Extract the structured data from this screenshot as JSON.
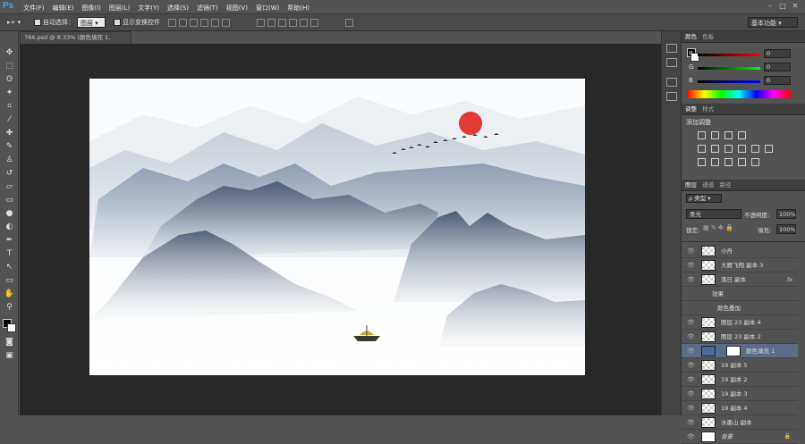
{
  "app": {
    "logo": "Ps"
  },
  "menu": [
    "文件(F)",
    "编辑(E)",
    "图像(I)",
    "图层(L)",
    "文字(Y)",
    "选择(S)",
    "滤镜(T)",
    "视图(V)",
    "窗口(W)",
    "帮助(H)"
  ],
  "options": {
    "auto_select_label": "自动选择：",
    "auto_select_value": "图层",
    "show_transform_label": "显示变换控件",
    "workspace": "基本功能"
  },
  "document": {
    "tab": "766.psd @ 8.33% (颜色填充 1, RGB/8)"
  },
  "color_panel": {
    "tabs": [
      "颜色",
      "色板"
    ],
    "r": {
      "label": "R",
      "value": "0"
    },
    "g": {
      "label": "G",
      "value": "0"
    },
    "b": {
      "label": "B",
      "value": "0"
    }
  },
  "adjust_panel": {
    "tabs": [
      "调整",
      "样式"
    ],
    "title": "添加调整"
  },
  "layers_panel": {
    "tabs": [
      "图层",
      "通道",
      "路径"
    ],
    "kind": "类型",
    "blend_mode": "柔光",
    "opacity_label": "不透明度:",
    "opacity": "100%",
    "lock_label": "锁定:",
    "fill_label": "填充:",
    "fill": "100%",
    "layers": [
      {
        "name": "小舟"
      },
      {
        "name": "大雁飞翔 副本 3"
      },
      {
        "name": "落日 副本",
        "fx": "fx"
      },
      {
        "name": "效果",
        "sub": true
      },
      {
        "name": "颜色叠加",
        "sub": true
      },
      {
        "name": "图层 23 副本 4"
      },
      {
        "name": "图层 23 副本 2"
      },
      {
        "name": "颜色填充 1",
        "selected": true
      },
      {
        "name": "19 副本 5"
      },
      {
        "name": "19 副本 2"
      },
      {
        "name": "19 副本 3"
      },
      {
        "name": "19 副本 4"
      },
      {
        "name": "水墨山 副本"
      },
      {
        "name": "背景"
      }
    ]
  }
}
